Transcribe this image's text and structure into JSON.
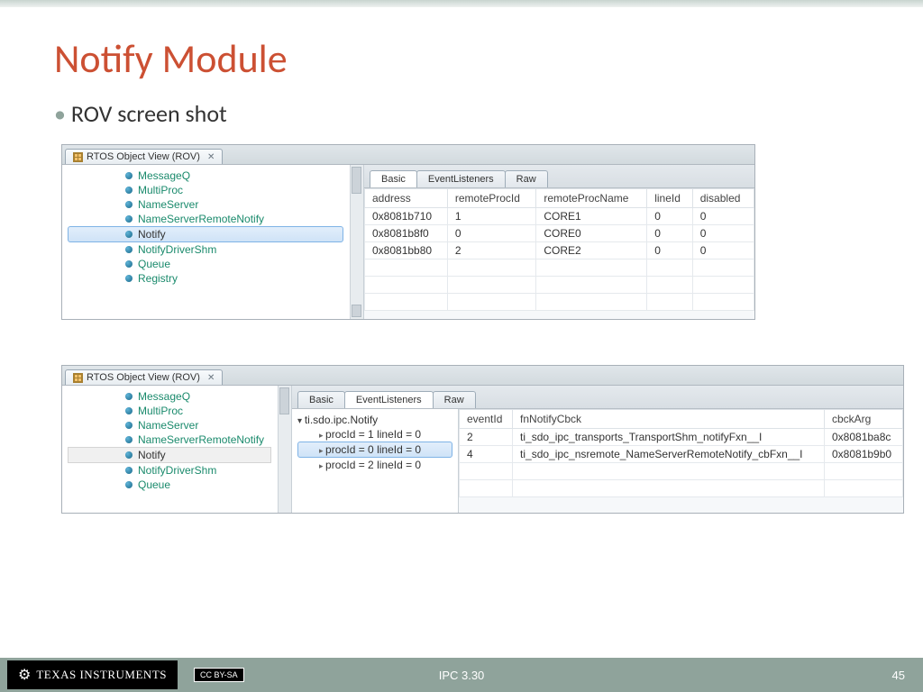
{
  "slide": {
    "title": "Notify Module",
    "bullet": "ROV screen shot"
  },
  "footer": {
    "logo": "TEXAS INSTRUMENTS",
    "license": "CC BY-SA",
    "center": "IPC 3.30",
    "page": "45"
  },
  "rov_title": "RTOS Object View (ROV)",
  "tree_items": [
    "MessageQ",
    "MultiProc",
    "NameServer",
    "NameServerRemoteNotify",
    "Notify",
    "NotifyDriverShm",
    "Queue",
    "Registry"
  ],
  "tree_items2": [
    "MessageQ",
    "MultiProc",
    "NameServer",
    "NameServerRemoteNotify",
    "Notify",
    "NotifyDriverShm",
    "Queue"
  ],
  "tabs": {
    "basic": "Basic",
    "eventlisteners": "EventListeners",
    "raw": "Raw"
  },
  "basic_table": {
    "headers": [
      "address",
      "remoteProcId",
      "remoteProcName",
      "lineId",
      "disabled"
    ],
    "rows": [
      [
        "0x8081b710",
        "1",
        "CORE1",
        "0",
        "0"
      ],
      [
        "0x8081b8f0",
        "0",
        "CORE0",
        "0",
        "0"
      ],
      [
        "0x8081bb80",
        "2",
        "CORE2",
        "0",
        "0"
      ]
    ]
  },
  "subtree": {
    "root": "ti.sdo.ipc.Notify",
    "items": [
      "procId = 1 lineId = 0",
      "procId = 0 lineId = 0",
      "procId = 2 lineId = 0"
    ]
  },
  "el_table": {
    "headers": [
      "eventId",
      "fnNotifyCbck",
      "cbckArg"
    ],
    "rows": [
      [
        "2",
        "ti_sdo_ipc_transports_TransportShm_notifyFxn__I",
        "0x8081ba8c"
      ],
      [
        "4",
        "ti_sdo_ipc_nsremote_NameServerRemoteNotify_cbFxn__I",
        "0x8081b9b0"
      ]
    ]
  }
}
